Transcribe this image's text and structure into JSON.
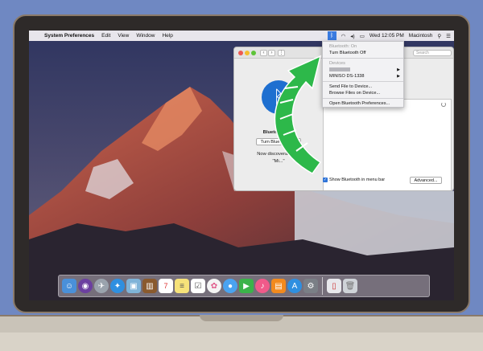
{
  "menubar": {
    "apple_icon": "apple-icon",
    "items": [
      "System Preferences",
      "Edit",
      "View",
      "Window",
      "Help"
    ],
    "clock": "Wed 12:05 PM",
    "user": "Macintosh",
    "status_icons": [
      "bluetooth-icon",
      "wifi-icon",
      "volume-icon",
      "battery-icon",
      "search-icon",
      "list-icon"
    ]
  },
  "bluetooth_menu": {
    "status": "Bluetooth: On",
    "turn_off": "Turn Bluetooth Off",
    "devices_header": "Devices",
    "device_2": "MINISO DS-1338",
    "send_file": "Send File to Device...",
    "browse_files": "Browse Files on Device...",
    "open_prefs": "Open Bluetooth Preferences..."
  },
  "prefs_window": {
    "search_placeholder": "Search",
    "state_title": "Bluetooth: On",
    "turn_off_button": "Turn Bluetooth Off",
    "discoverable_text": "Now discoverable as",
    "device_name": "\"Mi...\"",
    "show_in_menubar": "Show Bluetooth in menu bar",
    "advanced_button": "Advanced..."
  },
  "dock": {
    "icons": [
      "finder-icon",
      "siri-icon",
      "launchpad-icon",
      "safari-icon",
      "preview-icon",
      "notes-book-icon",
      "calendar-icon",
      "notes-icon",
      "reminders-icon",
      "photos-icon",
      "messages-icon",
      "facetime-icon",
      "itunes-icon",
      "ibooks-icon",
      "app-store-icon",
      "system-preferences-icon",
      "documents-icon",
      "trash-icon"
    ],
    "calendar_day": "7"
  },
  "colors": {
    "background": "#6f88c2",
    "accent_bluetooth": "#1e6fd0",
    "arrow_green": "#2db84a"
  }
}
